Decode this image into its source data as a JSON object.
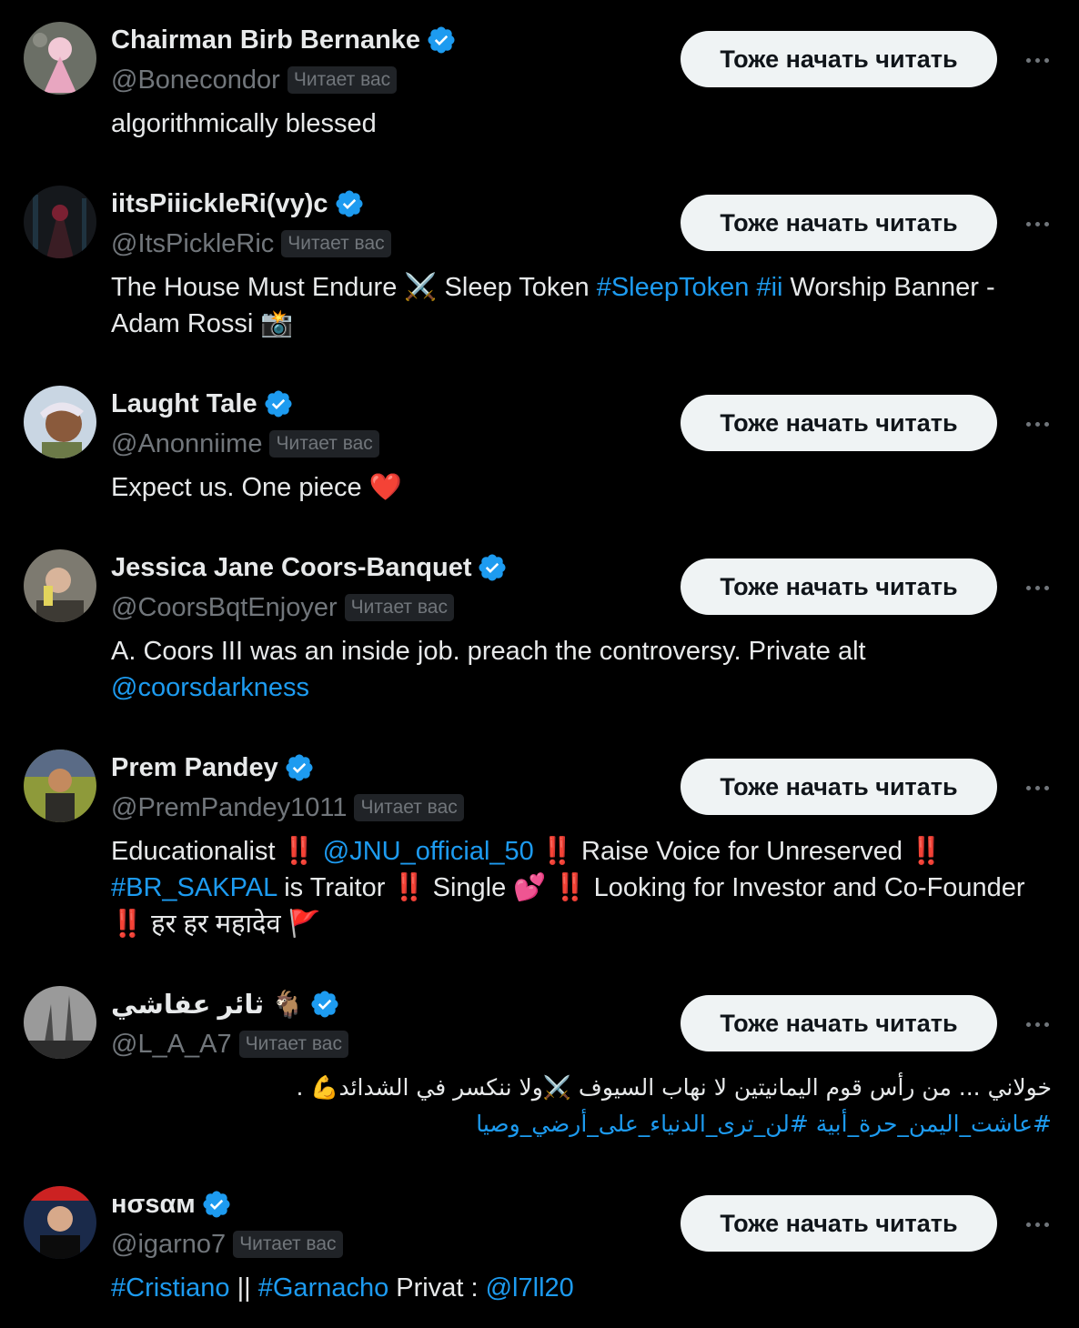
{
  "follow_button_label": "Тоже начать читать",
  "follows_you_label": "Читает вас",
  "users": [
    {
      "name": "Chairman Birb Bernanke",
      "handle": "@Bonecondor",
      "bio": "algorithmically blessed"
    },
    {
      "name": "iitsPiiickleRi(vy)c",
      "handle": "@ItsPickleRic",
      "bio_parts": [
        "The House Must Endure ⚔️ Sleep Token ",
        "#SleepToken",
        " ",
        "#ii",
        " Worship Banner - Adam Rossi 📸"
      ]
    },
    {
      "name": "Laught Tale",
      "handle": "@Anonniime",
      "bio": "Expect us. One piece ❤️"
    },
    {
      "name": "Jessica Jane Coors-Banquet",
      "handle": "@CoorsBqtEnjoyer",
      "bio_parts": [
        "A. Coors III was an inside job. preach the controversy. Private alt ",
        "@coorsdarkness"
      ]
    },
    {
      "name": "Prem Pandey",
      "handle": "@PremPandey1011",
      "bio_parts": [
        "Educationalist ",
        "‼️",
        " ",
        "@JNU_official_50",
        " ",
        "‼️",
        " Raise Voice for Unreserved ",
        "‼️",
        " ",
        "#BR_SAKPAL",
        " is Traitor ",
        "‼️",
        " Single 💕 ",
        "‼️",
        " Looking for Investor and Co-Founder ",
        "‼️",
        " हर हर महादेव 🚩"
      ]
    },
    {
      "name": "ثائر عفاشي 🐐",
      "handle": "@L_A_A7",
      "bio_parts": [
        "خولاني ... من رأس قوم اليمانيتين لا نهاب السيوف ⚔️ولا ننكسر في الشدائد💪 .",
        "#عاشت_اليمن_حرة_أبية #لن_ترى_الدنياء_على_أرضي_وصيا"
      ]
    },
    {
      "name": "нσѕαм",
      "handle": "@igarno7",
      "bio_parts": [
        "#Cristiano",
        " || ",
        "#Garnacho",
        " Privat : ",
        "@l7ll20"
      ]
    }
  ]
}
